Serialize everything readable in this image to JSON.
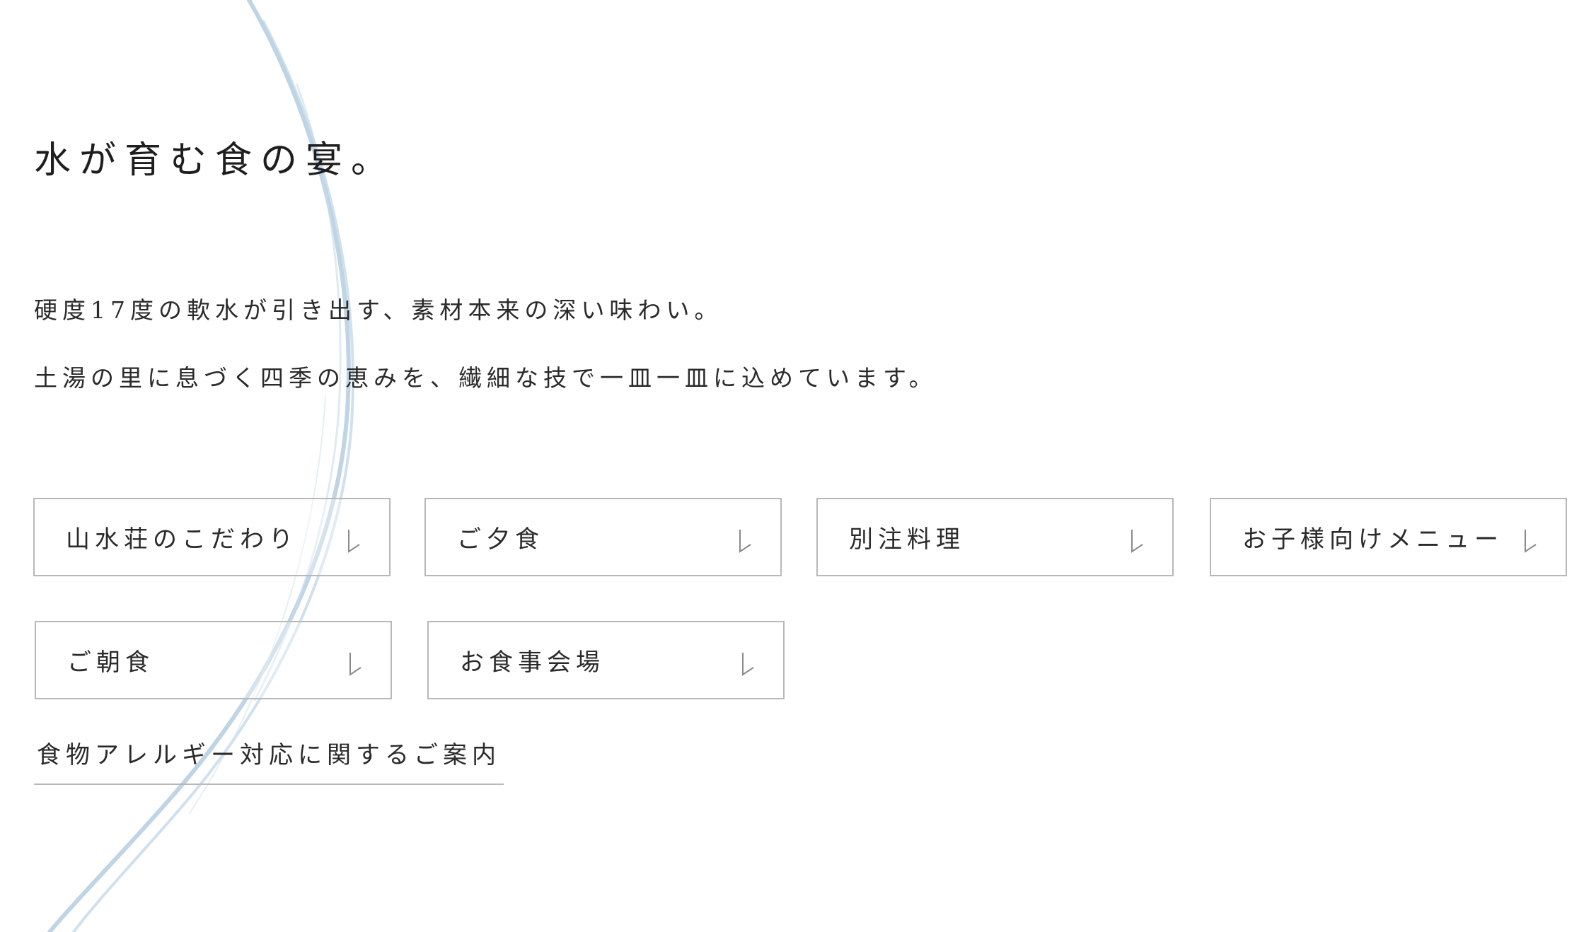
{
  "headline": "水が育む食の宴。",
  "lead": {
    "line1": "硬度17度の軟水が引き出す、素材本来の深い味わい。",
    "line2": "土湯の里に息づく四季の恵みを、繊細な技で一皿一皿に込めています。"
  },
  "menu_buttons": [
    {
      "label": "山水荘のこだわり",
      "icon": "arrow-down-icon"
    },
    {
      "label": "ご夕食",
      "icon": "arrow-down-icon"
    },
    {
      "label": "別注料理",
      "icon": "arrow-down-icon"
    },
    {
      "label": "お子様向けメニュー",
      "icon": "arrow-down-icon"
    },
    {
      "label": "ご朝食",
      "icon": "arrow-down-icon"
    },
    {
      "label": "お食事会場",
      "icon": "arrow-down-icon"
    }
  ],
  "allergy_link": {
    "label": "食物アレルギー対応に関するご案内"
  },
  "colors": {
    "text": "#2a2a2a",
    "border": "#b8b8b8",
    "water_stroke": "#9fbfd6",
    "background": "#ffffff"
  }
}
